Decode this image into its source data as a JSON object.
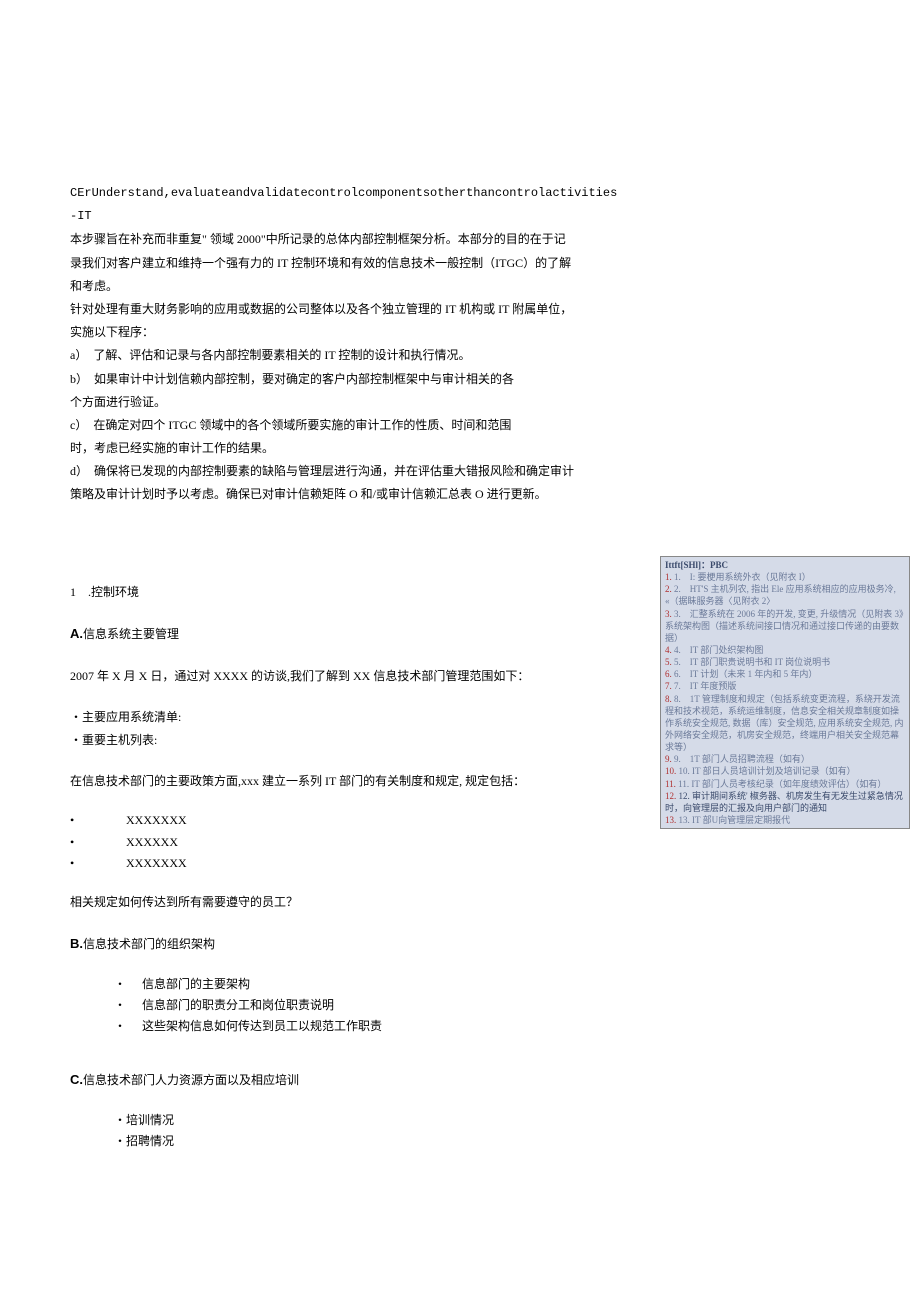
{
  "header": {
    "line1": "CErUnderstand,evaluateandvalidatecontrolcomponentsotherthancontrolactivities",
    "line2": "-IT"
  },
  "intro": [
    "本步骤旨在补充而非重复\" 领域 2000\"中所记录的总体内部控制框架分析。本部分的目的在于记",
    "录我们对客户建立和维持一个强有力的 IT 控制环境和有效的信息技术一般控制（ITGC）的了解",
    "和考虑。",
    "针对处理有重大财务影响的应用或数据的公司整体以及各个独立管理的 IT 机构或 IT 附属单位，",
    "实施以下程序："
  ],
  "steps": [
    "a）　了解、评估和记录与各内部控制要素相关的 IT 控制的设计和执行情况。",
    "b）　如果审计中计划信赖内部控制，要对确定的客户内部控制框架中与审计相关的各",
    "个方面进行验证。",
    "c）　在确定对四个 ITGC 领域中的各个领域所要实施的审计工作的性质、时间和范围",
    "时，考虑已经实施的审计工作的结果。",
    "d）　确保将已发现的内部控制要素的缺陷与管理层进行沟通，并在评估重大错报风险和确定审计",
    "策略及审计计划时予以考虑。确保已对审计信赖矩阵 O 和/或审计信赖汇总表 O 进行更新。"
  ],
  "section1": {
    "title": "1　.控制环境",
    "a_label": "A.",
    "a_text": "信息系统主要管理",
    "a_body": "2007 年 X 月 X 日，通过对 XXXX 的访谈,我们了解到 XX 信息技术部门管理范围如下：",
    "a_bullets": [
      "・主要应用系统清单:",
      "・重要主机列表:"
    ],
    "a_body2": "在信息技术部门的主要政策方面,xxx 建立一系列 IT 部门的有关制度和规定, 规定包括：",
    "a_x": [
      "XXXXXXX",
      "XXXXXX",
      "XXXXXXX"
    ],
    "a_q": "相关规定如何传达到所有需要遵守的员工？",
    "b_label": "B.",
    "b_text": "信息技术部门的组织架构",
    "b_bullets": [
      "信息部门的主要架构",
      "信息部门的职责分工和岗位职责说明",
      "这些架构信息如何传达到员工以规范工作职责"
    ],
    "c_label": "C.",
    "c_text": "信息技术部门人力资源方面以及相应培训",
    "c_bullets": [
      "・培训情况",
      "・招聘情况"
    ]
  },
  "comment": {
    "title": "Ittft[SHl]：PBC",
    "items": [
      "1.　I: 要梗用系统外衣（见附衣 I）",
      "2.　HT'S 主机列农, 指出 Ele 应用系统相应的应用极务冷, «（据眛服务器〈见附衣 2〉",
      "3.　汇整系统在 2006 年的开发, 变更, 升级情况（见附表 3》系统架构图（描述系统间接口情况和通过接口传递的由要数据）",
      "4.　IT 部门处织架构图",
      "5.　IT 部门职贵说明书和 IT 岗位说明书",
      "6.　IT 计划（未来 1 年内和 5 年内）",
      "7.　IT 年度预版",
      "",
      "8.　1T 管理制度和规定（包括系统变更流程，系绕开发流程和技术视范，系统运维制度，信息安全相关规章制度如操作系统安全规范, 数据（库）安全规范, 应用系统安全规范, 内外网络安全规范，机房安全规范，终端用户相关安全规范幕求等）",
      "9.　1T 部门人员招聘流程（如有）",
      "10. IT 部日人员培训计划及培训记录（如有）",
      "11. IT 部门人员考核纪录（如年度绩效评估）（如有）",
      "12. 审计期间系统' 椒务器、机房发生有无发生过紧急情况时，向管理层的汇报及向用户部门的通知",
      "13. IT 部U向管理层定期报代"
    ]
  }
}
